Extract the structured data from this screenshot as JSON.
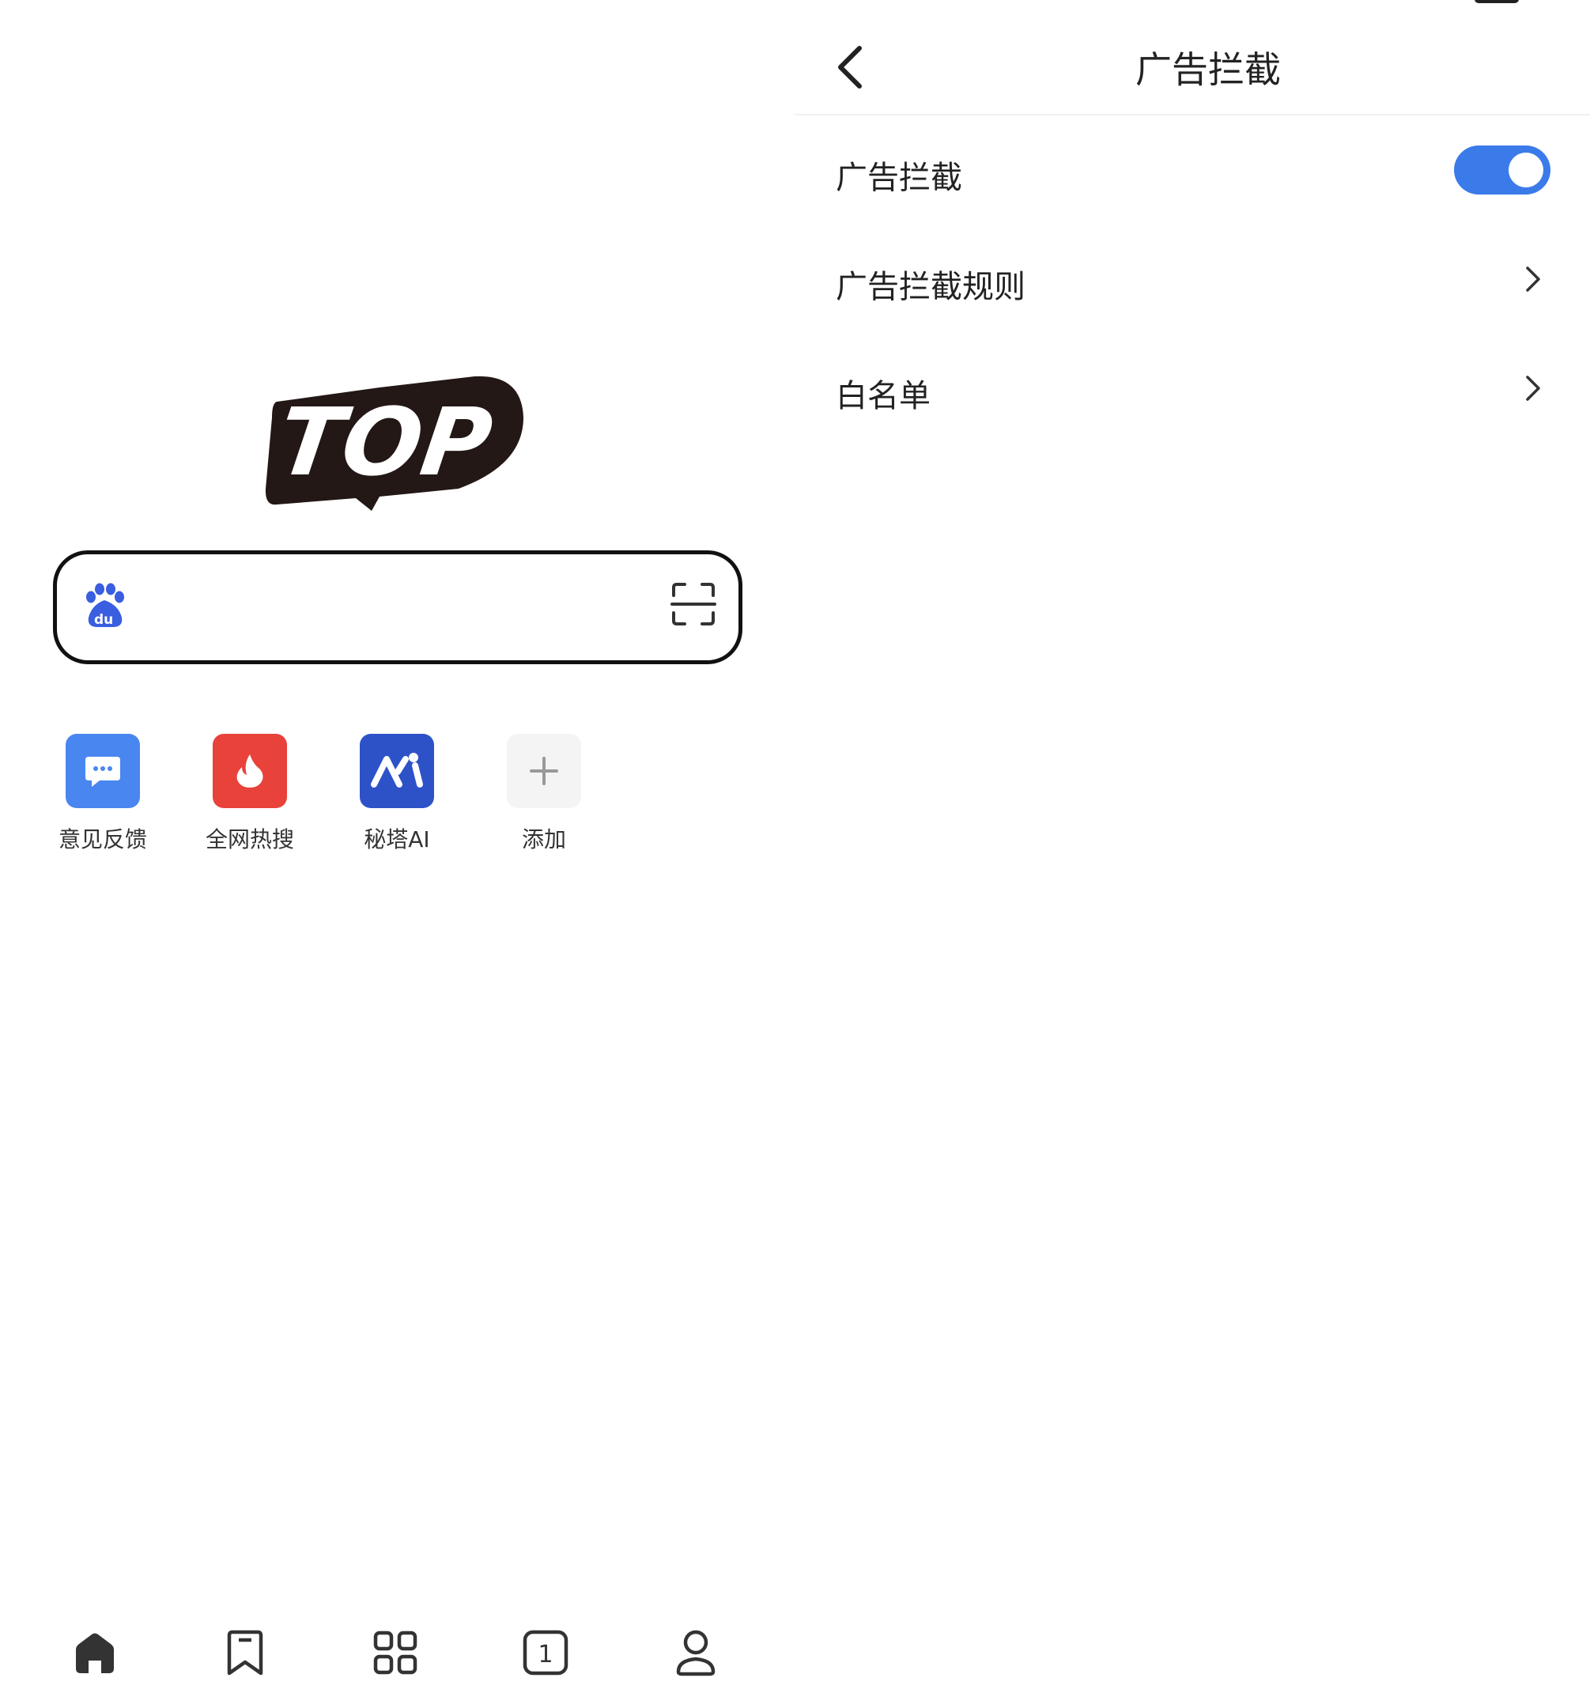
{
  "home": {
    "logo_text": "TOP",
    "search": {
      "engine_icon": "baidu-paw-icon",
      "scan_icon": "scan-icon"
    },
    "shortcuts": [
      {
        "label": "意见反馈",
        "icon": "chat-bubble-icon",
        "color": "#4a86f0"
      },
      {
        "label": "全网热搜",
        "icon": "fire-icon",
        "color": "#e8423a"
      },
      {
        "label": "秘塔AI",
        "icon": "metaso-icon",
        "color": "#2d52c8"
      },
      {
        "label": "添加",
        "icon": "plus-icon",
        "color": "#f4f4f4"
      }
    ],
    "bottom_nav": {
      "home_icon": "home-icon",
      "bookmarks_icon": "bookmark-icon",
      "apps_icon": "grid-icon",
      "tabs_count": "1",
      "profile_icon": "user-icon"
    }
  },
  "settings": {
    "title": "广告拦截",
    "accent_color": "#3b7be9",
    "rows": [
      {
        "label": "广告拦截",
        "control": "toggle",
        "enabled": true
      },
      {
        "label": "广告拦截规则",
        "control": "chevron"
      },
      {
        "label": "白名单",
        "control": "chevron"
      }
    ]
  }
}
